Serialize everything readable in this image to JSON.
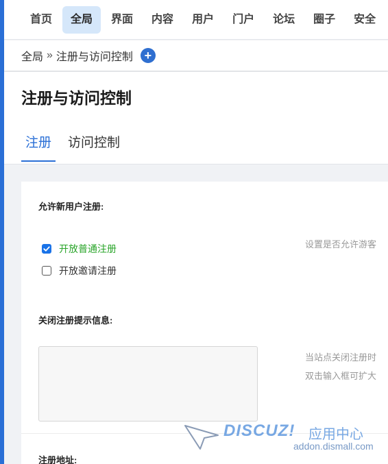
{
  "topnav": {
    "items": [
      {
        "label": "首页",
        "active": false
      },
      {
        "label": "全局",
        "active": true
      },
      {
        "label": "界面",
        "active": false
      },
      {
        "label": "内容",
        "active": false
      },
      {
        "label": "用户",
        "active": false
      },
      {
        "label": "门户",
        "active": false
      },
      {
        "label": "论坛",
        "active": false
      },
      {
        "label": "圈子",
        "active": false
      },
      {
        "label": "安全",
        "active": false
      }
    ]
  },
  "breadcrumb": {
    "root": "全局",
    "separator": "»",
    "current": "注册与访问控制",
    "add_icon": "plus-circle-icon"
  },
  "page": {
    "title": "注册与访问控制",
    "tabs": [
      {
        "label": "注册",
        "active": true
      },
      {
        "label": "访问控制",
        "active": false
      }
    ]
  },
  "form": {
    "allow_register": {
      "label": "允许新用户注册:",
      "options": [
        {
          "label": "开放普通注册",
          "checked": true
        },
        {
          "label": "开放邀请注册",
          "checked": false
        }
      ],
      "hint": "设置是否允许游客"
    },
    "closed_message": {
      "label": "关闭注册提示信息:",
      "value": "",
      "hint_line1": "当站点关闭注册时",
      "hint_line2": "双击输入框可扩大"
    },
    "register_url": {
      "label": "注册地址:"
    }
  },
  "watermark": {
    "brand": "DISCUZ!",
    "subtitle": "应用中心",
    "url": "addon.dismall.com"
  },
  "colors": {
    "accent": "#2a6fd6",
    "active_nav_bg": "#d5e7fa",
    "checked_label": "#2aa52a",
    "checkbox_blue": "#1a73e8"
  }
}
